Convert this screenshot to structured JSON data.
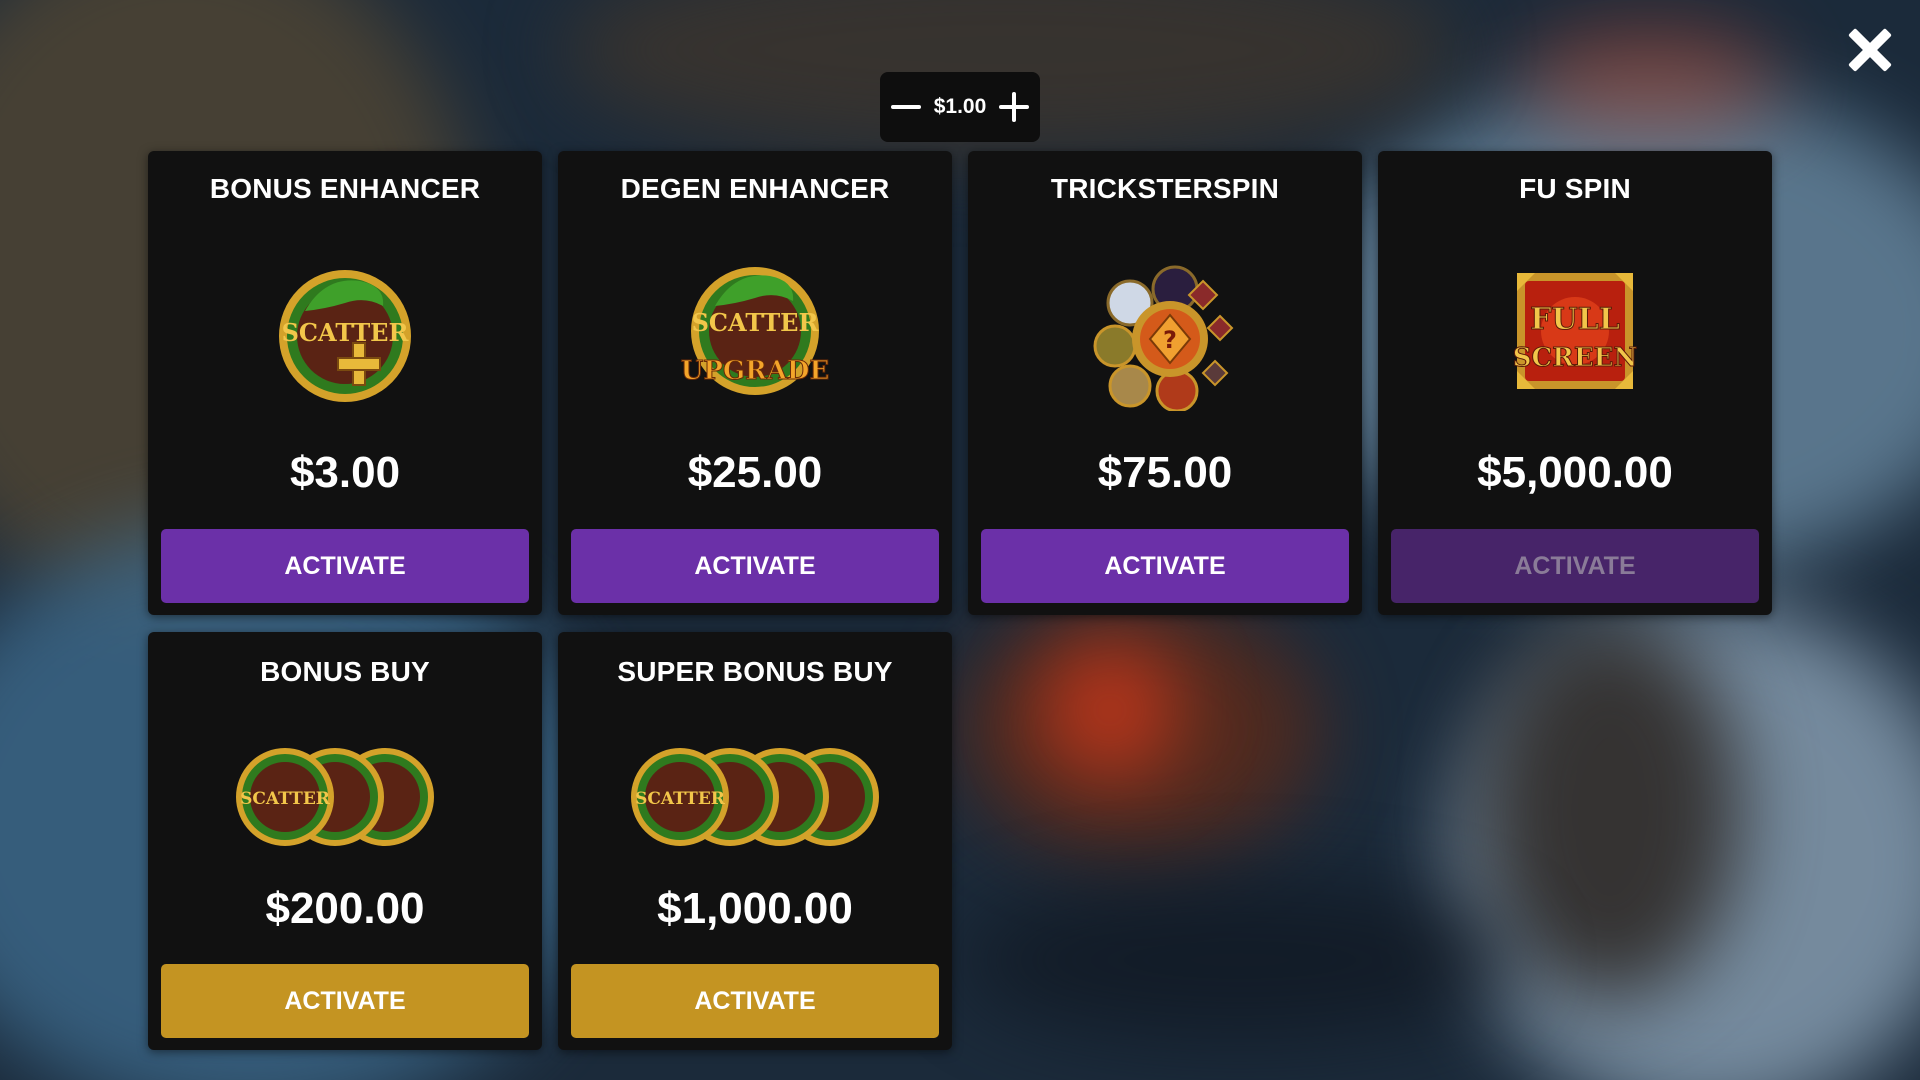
{
  "topbar": {
    "bet_value": "$1.00",
    "close_icon": "close-icon"
  },
  "cards": [
    {
      "title": "BONUS ENHANCER",
      "price": "$3.00",
      "button": "ACTIVATE",
      "button_style": "purple",
      "icon": "scatter-plus-icon"
    },
    {
      "title": "DEGEN ENHANCER",
      "price": "$25.00",
      "button": "ACTIVATE",
      "button_style": "purple",
      "icon": "scatter-upgrade-icon"
    },
    {
      "title": "TRICKSTERSPIN",
      "price": "$75.00",
      "button": "ACTIVATE",
      "button_style": "purple",
      "icon": "trickster-wheel-icon"
    },
    {
      "title": "FU SPIN",
      "price": "$5,000.00",
      "button": "ACTIVATE",
      "button_style": "purple-disabled",
      "icon": "full-screen-icon"
    },
    {
      "title": "BONUS BUY",
      "price": "$200.00",
      "button": "ACTIVATE",
      "button_style": "gold",
      "icon": "three-scatter-icon"
    },
    {
      "title": "SUPER BONUS BUY",
      "price": "$1,000.00",
      "button": "ACTIVATE",
      "button_style": "gold",
      "icon": "four-scatter-icon"
    }
  ],
  "art_text": {
    "scatter": "SCATTER",
    "upgrade": "UPGRADE",
    "full": "FULL",
    "screen": "SCREEN"
  },
  "colors": {
    "card_bg": "#111111",
    "button_purple": "#6b30a8",
    "button_purple_disabled": "#472469",
    "button_gold": "#c49422"
  }
}
